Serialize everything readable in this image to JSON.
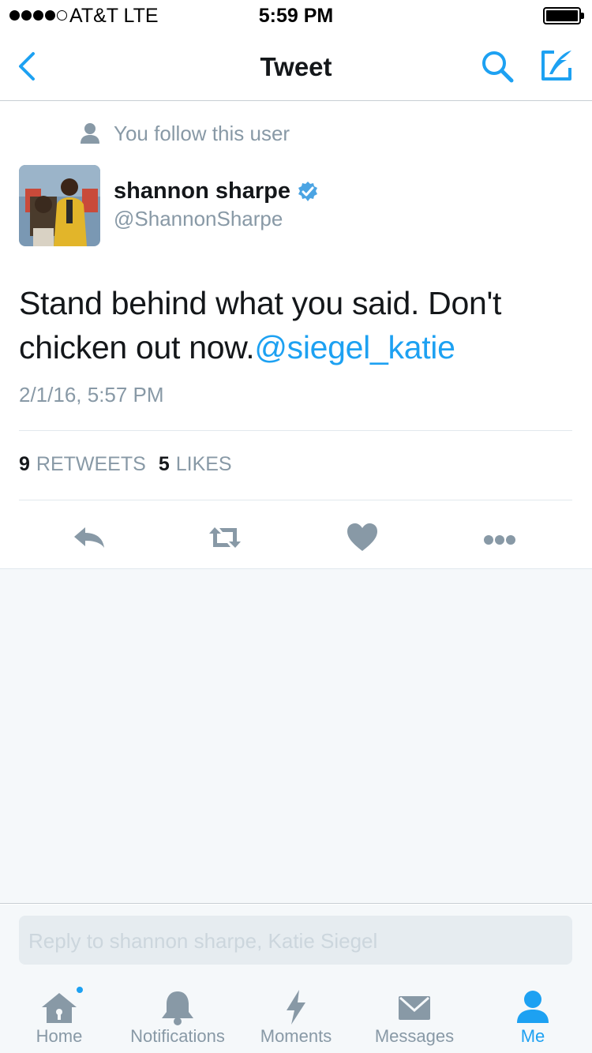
{
  "status_bar": {
    "carrier": "AT&T  LTE",
    "time": "5:59 PM",
    "signal_bars_filled": 4,
    "signal_bars_total": 5
  },
  "nav": {
    "title": "Tweet",
    "back_icon": "chevron-left-icon",
    "search_icon": "search-icon",
    "compose_icon": "compose-icon"
  },
  "tweet": {
    "context": "You follow this user",
    "name": "shannon sharpe",
    "handle": "@ShannonSharpe",
    "text": "Stand behind what you said. Don't chicken out now.",
    "mention": "@siegel_katie",
    "timestamp": "2/1/16, 5:57 PM",
    "retweet_count": "9",
    "retweet_label": "RETWEETS",
    "like_count": "5",
    "like_label": "LIKES"
  },
  "reply": {
    "placeholder": "Reply to shannon sharpe, Katie Siegel"
  },
  "tabs": [
    {
      "label": "Home",
      "icon": "home-icon"
    },
    {
      "label": "Notifications",
      "icon": "bell-icon"
    },
    {
      "label": "Moments",
      "icon": "lightning-icon"
    },
    {
      "label": "Messages",
      "icon": "envelope-icon"
    },
    {
      "label": "Me",
      "icon": "person-icon"
    }
  ],
  "colors": {
    "accent": "#1da1f2",
    "muted": "#8899a6",
    "text": "#14171a",
    "background_gray": "#f5f8fa"
  }
}
